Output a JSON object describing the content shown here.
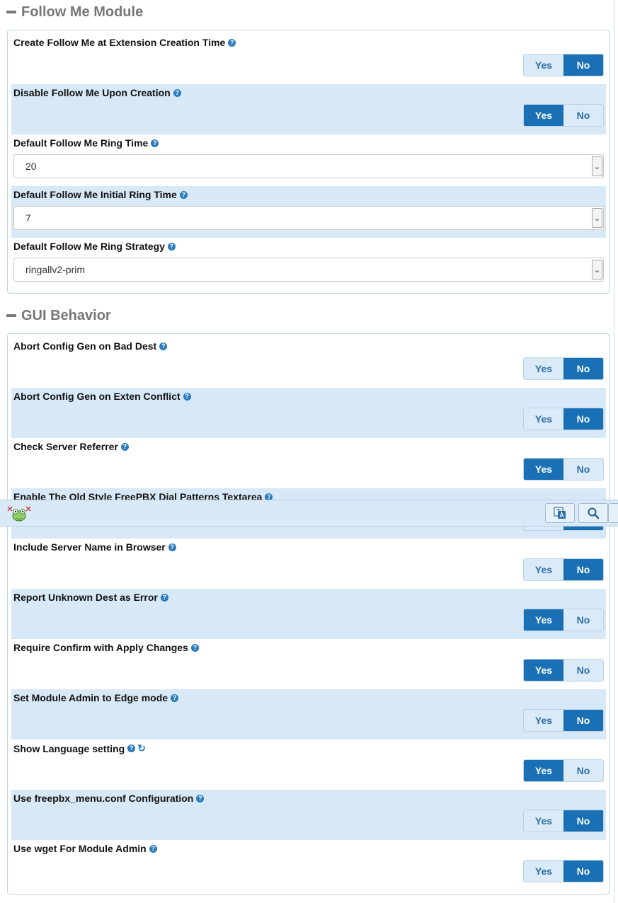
{
  "sections": [
    {
      "title": "Follow Me Module",
      "rows": [
        {
          "label": "Create Follow Me at Extension Creation Time",
          "type": "toggle",
          "value": "No"
        },
        {
          "label": "Disable Follow Me Upon Creation",
          "type": "toggle",
          "value": "Yes"
        },
        {
          "label": "Default Follow Me Ring Time",
          "type": "select",
          "value": "20"
        },
        {
          "label": "Default Follow Me Initial Ring Time",
          "type": "select",
          "value": "7"
        },
        {
          "label": "Default Follow Me Ring Strategy",
          "type": "select",
          "value": "ringallv2-prim"
        }
      ]
    },
    {
      "title": "GUI Behavior",
      "rows": [
        {
          "label": "Abort Config Gen on Bad Dest",
          "type": "toggle",
          "value": "No"
        },
        {
          "label": "Abort Config Gen on Exten Conflict",
          "type": "toggle",
          "value": "No"
        },
        {
          "label": "Check Server Referrer",
          "type": "toggle",
          "value": "Yes"
        },
        {
          "label": "Enable The Old Style FreePBX Dial Patterns Textarea",
          "type": "toggle",
          "value": "No"
        },
        {
          "label": "Include Server Name in Browser",
          "type": "toggle",
          "value": "No"
        },
        {
          "label": "Report Unknown Dest as Error",
          "type": "toggle",
          "value": "Yes"
        },
        {
          "label": "Require Confirm with Apply Changes",
          "type": "toggle",
          "value": "Yes"
        },
        {
          "label": "Set Module Admin to Edge mode",
          "type": "toggle",
          "value": "No"
        },
        {
          "label": "Show Language setting",
          "type": "toggle",
          "value": "Yes",
          "refresh": true
        },
        {
          "label": "Use freepbx_menu.conf Configuration",
          "type": "toggle",
          "value": "No"
        },
        {
          "label": "Use wget For Module Admin",
          "type": "toggle",
          "value": "No"
        }
      ]
    }
  ],
  "toggle_labels": {
    "yes": "Yes",
    "no": "No"
  },
  "help_glyph": "?",
  "refresh_glyph": "↻",
  "select_caret": "⌄",
  "floating_bar": {
    "icons": [
      "freepbx-frog-logo-icon",
      "translate-icon",
      "search-icon"
    ]
  },
  "colors": {
    "accent": "#1a70b5",
    "row_alt": "#d7e8f6",
    "header_gray": "#777777"
  }
}
